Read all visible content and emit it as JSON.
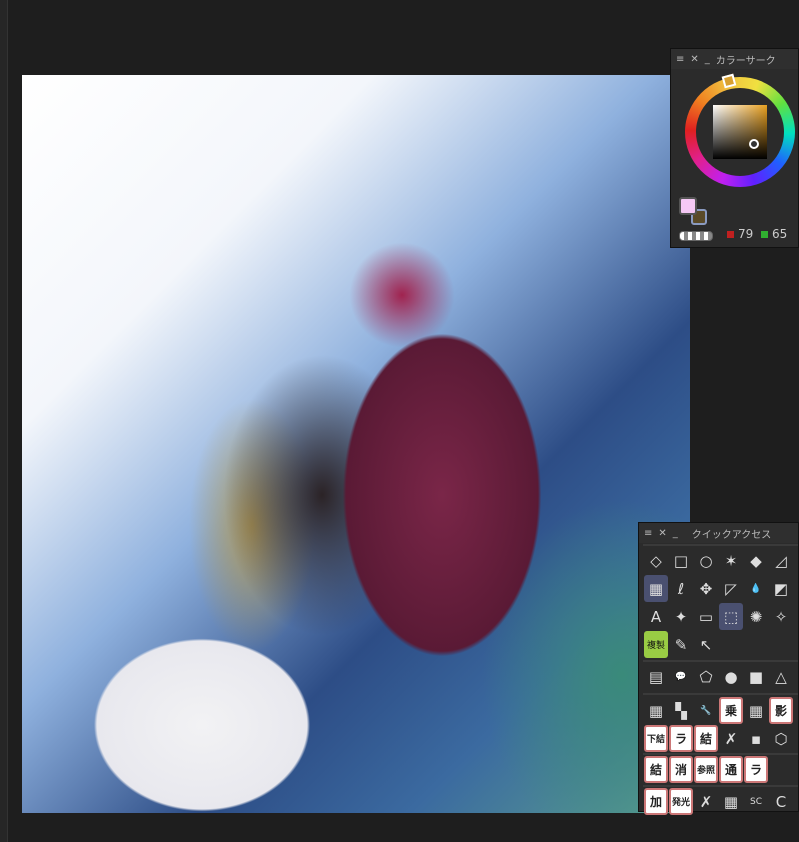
{
  "canvas": {
    "description_label": ""
  },
  "color_panel": {
    "title": "カラーサーク",
    "red_value": "79",
    "green_value": "65",
    "main_color": "#f5c8f5",
    "sub_color": "#5a4a28"
  },
  "quick_access": {
    "title": "クイックアクセス",
    "rows": [
      [
        "◇",
        "□",
        "○",
        "✶",
        "◆",
        "◿"
      ],
      [
        "▦",
        "ℓ",
        "✥",
        "◸",
        "💧",
        "◩"
      ],
      [
        "A",
        "✦",
        "▭",
        "⬚",
        "✺",
        "✧"
      ],
      [
        "複製",
        "✎",
        "↖",
        "",
        "",
        ""
      ],
      [
        "▤",
        "💬",
        "⬠",
        "●",
        "■",
        "△"
      ],
      [
        "▦",
        "▚",
        "🔧",
        "乗",
        "▦",
        "影"
      ],
      [
        "下結",
        "ラ",
        "結",
        "✗",
        "▪",
        "⬡"
      ],
      [
        "結",
        "消",
        "参照",
        "通",
        "ラ",
        ""
      ],
      [
        "加",
        "発光",
        "✗",
        "▦",
        "SC",
        "C"
      ]
    ]
  }
}
